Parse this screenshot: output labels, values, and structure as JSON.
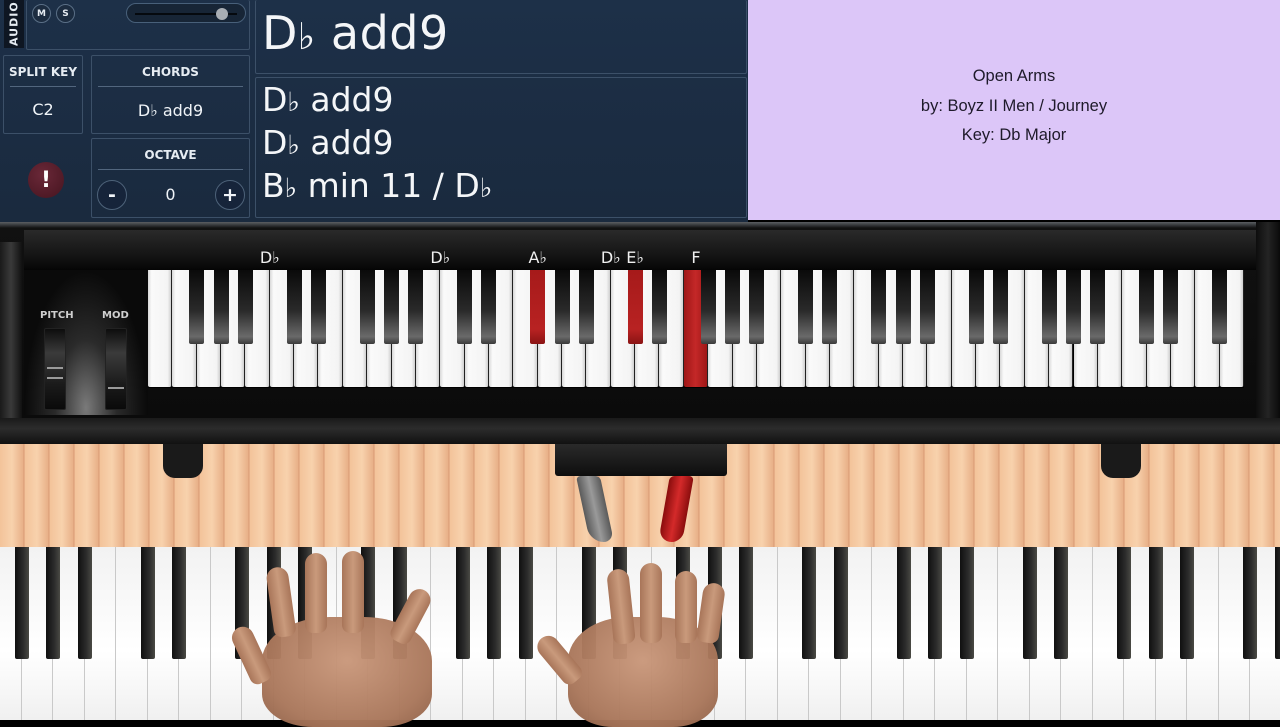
{
  "audio_panel": {
    "tab_label": "AUDIO",
    "mute_label": "M",
    "solo_label": "S",
    "volume_level": 0.82
  },
  "split_key": {
    "label": "SPLIT KEY",
    "value": "C2"
  },
  "chords": {
    "label": "CHORDS",
    "value": "D♭ add9"
  },
  "octave": {
    "label": "OCTAVE",
    "value": "0",
    "decrement_label": "-",
    "increment_label": "+"
  },
  "alert_icon": "!",
  "current_chord": {
    "root": "D",
    "accidental": "♭",
    "quality": " add9"
  },
  "chord_history": [
    {
      "root": "D",
      "accidental": "♭",
      "rest": " add9"
    },
    {
      "root": "D",
      "accidental": "♭",
      "rest": " add9"
    },
    {
      "root": "B",
      "accidental": "♭",
      "rest": " min 11 / D",
      "bass_accidental": "♭"
    }
  ],
  "song_info": {
    "title": "Open Arms",
    "artist_line": "by: Boyz II Men / Journey",
    "key_line": "Key: Db Major"
  },
  "wheels": {
    "pitch_label": "PITCH",
    "mod_label": "MOD"
  },
  "virtual_keyboard": {
    "lowest_white_note": "E",
    "white_key_count": 45,
    "highlighted_notes": [
      {
        "label": "D♭",
        "color": "blue",
        "white_index_after": 5,
        "type": "black"
      },
      {
        "label": "D♭",
        "color": "red",
        "white_index_after": 12,
        "type": "black"
      },
      {
        "label": "A♭",
        "color": "red",
        "white_index_after": 16,
        "type": "black"
      },
      {
        "label": "D♭",
        "color": "red",
        "white_index_after": 19,
        "type": "black"
      },
      {
        "label": "E♭",
        "color": "red",
        "white_index_after": 20,
        "type": "black"
      },
      {
        "label": "F",
        "color": "red",
        "white_index": 22,
        "type": "white"
      }
    ]
  },
  "colors": {
    "panel_bg": "#1b2c42",
    "song_info_bg": "#dcc6f8",
    "highlight_blue": "#1b5fd0",
    "highlight_red": "#b82222"
  },
  "pedals": {
    "sustain_pressed": true
  }
}
